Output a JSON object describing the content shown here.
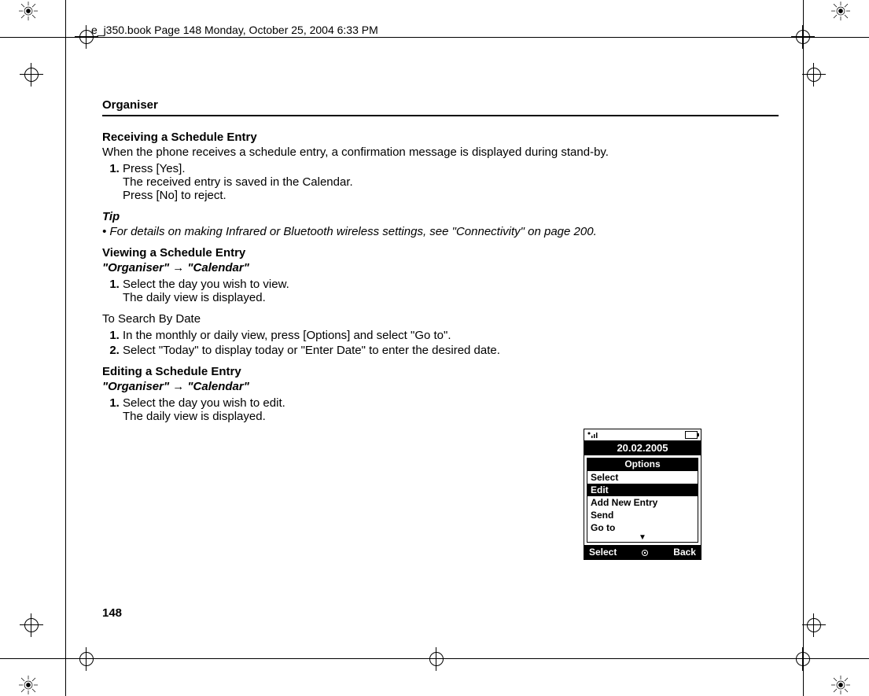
{
  "meta": {
    "header_line": "e_j350.book  Page 148  Monday, October 25, 2004  6:33 PM"
  },
  "page": {
    "section": "Organiser",
    "number": "148",
    "h_recv": "Receiving a Schedule Entry",
    "recv_p1": "When the phone receives a schedule entry, a confirmation message is displayed during stand-by.",
    "recv_step1": "Press [Yes].",
    "recv_step1_sub1": "The received entry is saved in the Calendar.",
    "recv_step1_sub2": "Press [No] to reject.",
    "tip_head": "Tip",
    "tip_body": "•  For details on making Infrared or Bluetooth wireless settings, see \"Connectivity\" on page 200.",
    "h_view": "Viewing a Schedule Entry",
    "nav_view": "\"Organiser\" → \"Calendar\"",
    "view_step1": "Select the day you wish to view.",
    "view_step1_sub": "The daily view is displayed.",
    "search_head": "To Search By Date",
    "search_step1": "In the monthly or daily view, press [Options] and select \"Go to\".",
    "search_step2": "Select \"Today\" to display today or \"Enter Date\" to enter the desired date.",
    "h_edit": "Editing a Schedule Entry",
    "nav_edit": "\"Organiser\" → \"Calendar\"",
    "edit_step1": "Select the day you wish to edit.",
    "edit_step1_sub": "The daily view is displayed."
  },
  "phone": {
    "date": "20.02.2005",
    "options_title": "Options",
    "items": {
      "i0": "Select",
      "i1": "Edit",
      "i2": "Add New Entry",
      "i3": "Send",
      "i4": "Go to"
    },
    "soft_left": "Select",
    "soft_right": "Back"
  }
}
